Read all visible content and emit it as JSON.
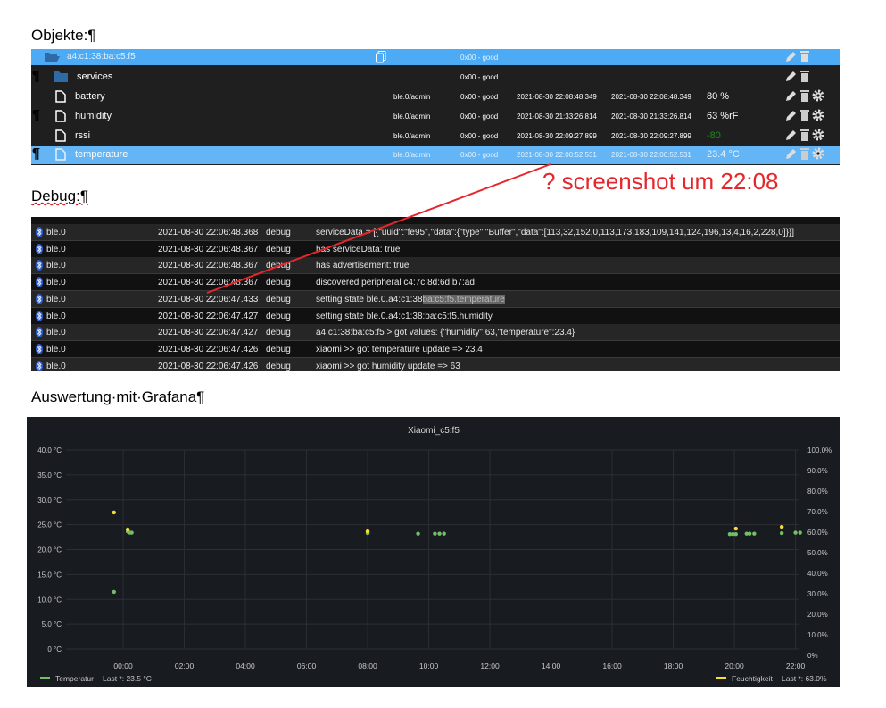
{
  "headings": {
    "objects": "Objekte:¶",
    "debug": "Debug:¶",
    "grafana": "Auswertung·mit·Grafana¶"
  },
  "pilcrow": "¶",
  "objects": {
    "device": {
      "name": "a4:c1:38:ba:c5:f5",
      "status": "0x00 - good"
    },
    "rows": [
      {
        "name": "services",
        "icon": "folder",
        "role": "",
        "status": "0x00 - good",
        "ts": "",
        "lc": "",
        "value": "",
        "settings": false
      },
      {
        "name": "battery",
        "icon": "file",
        "role": "ble.0/admin",
        "status": "0x00 - good",
        "ts": "2021-08-30 22:08:48.349",
        "lc": "2021-08-30 22:08:48.349",
        "value": "80 %",
        "settings": true
      },
      {
        "name": "humidity",
        "icon": "file",
        "role": "ble.0/admin",
        "status": "0x00 - good",
        "ts": "2021-08-30 21:33:26.814",
        "lc": "2021-08-30 21:33:26.814",
        "value": "63 %rF",
        "settings": true
      },
      {
        "name": "rssi",
        "icon": "file",
        "role": "ble.0/admin",
        "status": "0x00 - good",
        "ts": "2021-08-30 22:09:27.899",
        "lc": "2021-08-30 22:09:27.899",
        "value": "-80",
        "settings": true
      },
      {
        "name": "temperature",
        "icon": "file",
        "role": "ble.0/admin",
        "status": "0x00 - good",
        "ts": "2021-08-30 22:00:52.531",
        "lc": "2021-08-30 22:00:52.531",
        "value": "23.4 °C",
        "settings": true
      }
    ]
  },
  "annotation": "? screenshot um 22:08",
  "debug": {
    "rows": [
      {
        "src": "ble.0",
        "time": "2021-08-30 22:06:48.368",
        "level": "debug",
        "msg": "serviceData = [{\"uuid\":\"fe95\",\"data\":{\"type\":\"Buffer\",\"data\":[113,32,152,0,113,173,183,109,141,124,196,13,4,16,2,228,0]}}]"
      },
      {
        "src": "ble.0",
        "time": "2021-08-30 22:06:48.367",
        "level": "debug",
        "msg": "has serviceData: true"
      },
      {
        "src": "ble.0",
        "time": "2021-08-30 22:06:48.367",
        "level": "debug",
        "msg": "has advertisement: true"
      },
      {
        "src": "ble.0",
        "time": "2021-08-30 22:06:48.367",
        "level": "debug",
        "msg": "discovered peripheral c4:7c:8d:6d:b7:ad"
      },
      {
        "src": "ble.0",
        "time": "2021-08-30 22:06:47.433",
        "level": "debug",
        "msg": "setting state ble.0.a4:c1:38",
        "msg_hl": "ba:c5:f5.temperature"
      },
      {
        "src": "ble.0",
        "time": "2021-08-30 22:06:47.427",
        "level": "debug",
        "msg": "setting state ble.0.a4:c1:38:ba:c5:f5.humidity"
      },
      {
        "src": "ble.0",
        "time": "2021-08-30 22:06:47.427",
        "level": "debug",
        "msg": "a4:c1:38:ba:c5:f5 > got values: {\"humidity\":63,\"temperature\":23.4}"
      },
      {
        "src": "ble.0",
        "time": "2021-08-30 22:06:47.426",
        "level": "debug",
        "msg": "xiaomi >> got temperature update => 23.4"
      },
      {
        "src": "ble.0",
        "time": "2021-08-30 22:06:47.426",
        "level": "debug",
        "msg": "xiaomi >> got humidity update => 63"
      }
    ]
  },
  "chart_data": {
    "type": "scatter",
    "title": "Xiaomi_c5:f5",
    "x_unit": "hours since 00:00",
    "xlim": [
      -1.87,
      22.1
    ],
    "xticks": [
      "00:00",
      "02:00",
      "04:00",
      "06:00",
      "08:00",
      "10:00",
      "12:00",
      "14:00",
      "16:00",
      "18:00",
      "20:00",
      "22:00"
    ],
    "ylim_left": [
      0,
      40
    ],
    "yticks_left": [
      "0 °C",
      "5.0 °C",
      "10.0 °C",
      "15.0 °C",
      "20.0 °C",
      "25.0 °C",
      "30.0 °C",
      "35.0 °C",
      "40.0 °C"
    ],
    "ylim_right": [
      0,
      100
    ],
    "yticks_right": [
      "0%",
      "10.0%",
      "20.0%",
      "30.0%",
      "40.0%",
      "50.0%",
      "60.0%",
      "70.0%",
      "80.0%",
      "90.0%",
      "100.0%"
    ],
    "grid": true,
    "series": [
      {
        "name": "Temperatur",
        "legend": "Last *: 23.5 °C",
        "color": "#73bf69",
        "axis": "left",
        "points": [
          [
            -0.3,
            11.5
          ],
          [
            0.15,
            23.6
          ],
          [
            0.22,
            23.4
          ],
          [
            0.28,
            23.4
          ],
          [
            8.0,
            23.3
          ],
          [
            9.65,
            23.2
          ],
          [
            10.2,
            23.2
          ],
          [
            10.35,
            23.2
          ],
          [
            10.5,
            23.2
          ],
          [
            19.85,
            23.1
          ],
          [
            19.95,
            23.1
          ],
          [
            20.05,
            23.1
          ],
          [
            20.4,
            23.2
          ],
          [
            20.5,
            23.2
          ],
          [
            20.65,
            23.2
          ],
          [
            21.55,
            23.3
          ],
          [
            22.0,
            23.4
          ],
          [
            22.15,
            23.4
          ]
        ]
      },
      {
        "name": "Feuchtigkeit",
        "legend": "Last *: 63.0%",
        "color": "#fade2a",
        "axis": "right",
        "points": [
          [
            -0.3,
            69.6
          ],
          [
            0.15,
            61.3
          ],
          [
            8.0,
            60.4
          ],
          [
            20.05,
            61.7
          ],
          [
            21.55,
            62.6
          ]
        ]
      }
    ]
  }
}
